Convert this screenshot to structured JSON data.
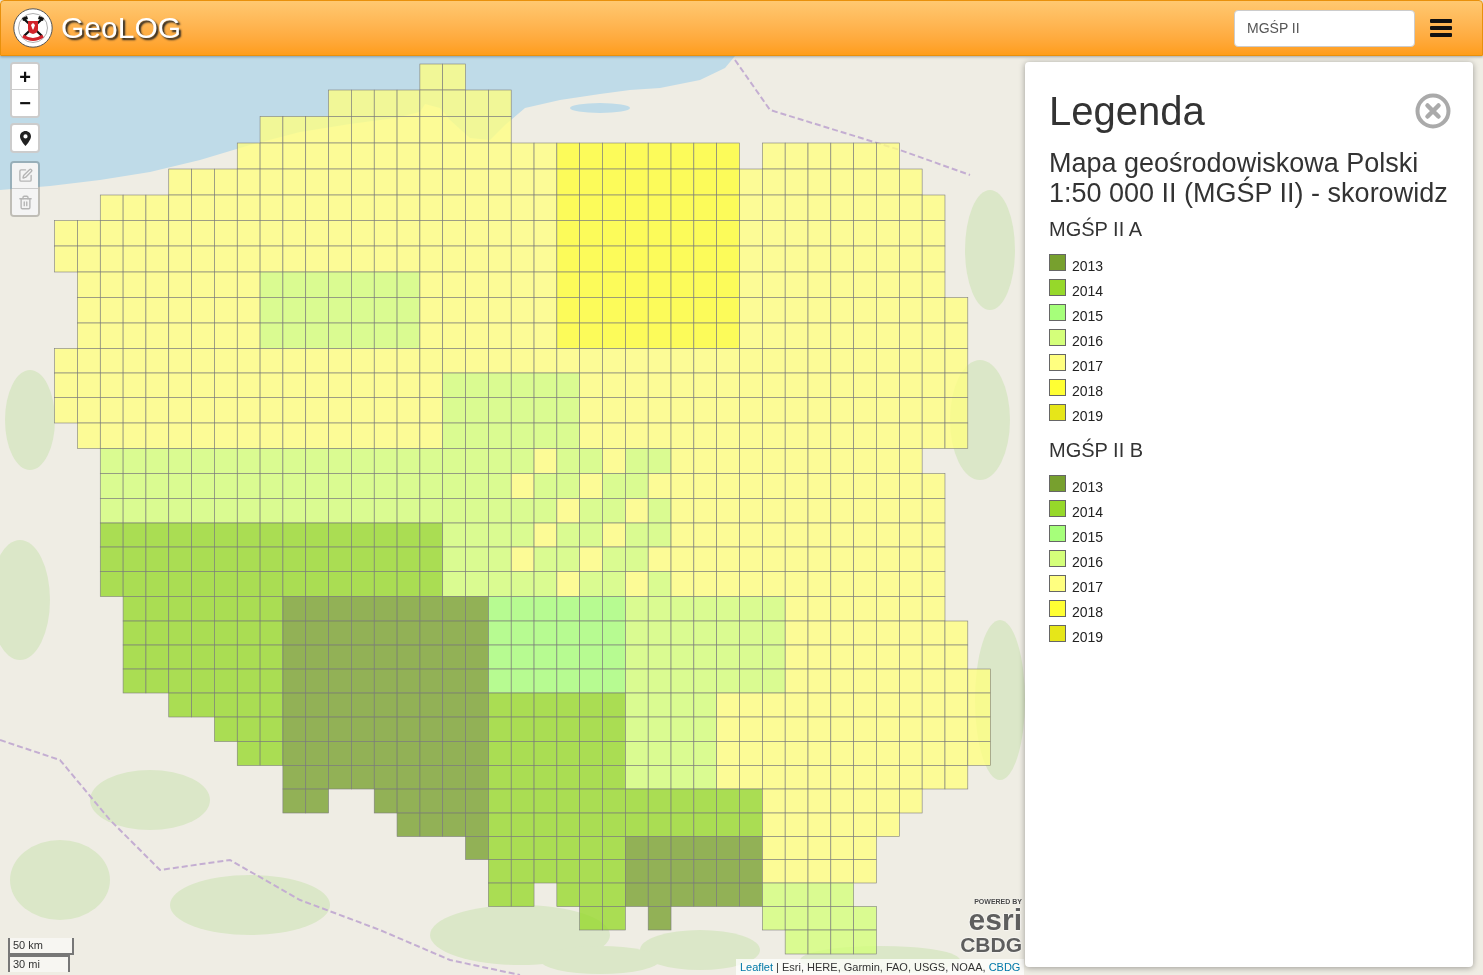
{
  "header": {
    "title": "GeoLOG",
    "search": {
      "value": "MGŚP II"
    }
  },
  "map": {
    "zoom": {
      "zoom_in": "+",
      "zoom_out": "−"
    },
    "draw_tools": [
      {
        "kind": "edit",
        "disabled": true
      },
      {
        "kind": "delete",
        "disabled": true
      }
    ],
    "scale": {
      "metric": "50 km",
      "imperial": "30 mi"
    },
    "logo": {
      "caption": "POWERED BY",
      "name": "esri",
      "partner": "CBDG"
    },
    "attribution": {
      "leaflet_link": "Leaflet",
      "separator": "|",
      "sources": "Esri, HERE, Garmin, FAO, USGS, NOAA,",
      "provider_link": "CBDG"
    }
  },
  "legend": {
    "title": "Legenda",
    "subtitle": "Mapa geośrodowiskowa Polski 1:50 000 II (MGŚP II) - skorowidz",
    "sections": [
      {
        "title": "MGŚP II A",
        "items": [
          {
            "label": "2013",
            "color": "#77a02e"
          },
          {
            "label": "2014",
            "color": "#96d82a"
          },
          {
            "label": "2015",
            "color": "#a6ff7a"
          },
          {
            "label": "2016",
            "color": "#d4ff7a"
          },
          {
            "label": "2017",
            "color": "#ffff80"
          },
          {
            "label": "2018",
            "color": "#ffff33"
          },
          {
            "label": "2019",
            "color": "#e6e619"
          }
        ]
      },
      {
        "title": "MGŚP II B",
        "items": [
          {
            "label": "2013",
            "color": "#77a02e"
          },
          {
            "label": "2014",
            "color": "#96d82a"
          },
          {
            "label": "2015",
            "color": "#a6ff7a"
          },
          {
            "label": "2016",
            "color": "#d4ff7a"
          },
          {
            "label": "2017",
            "color": "#ffff80"
          },
          {
            "label": "2018",
            "color": "#ffff33"
          },
          {
            "label": "2019",
            "color": "#e6e619"
          }
        ]
      }
    ]
  }
}
